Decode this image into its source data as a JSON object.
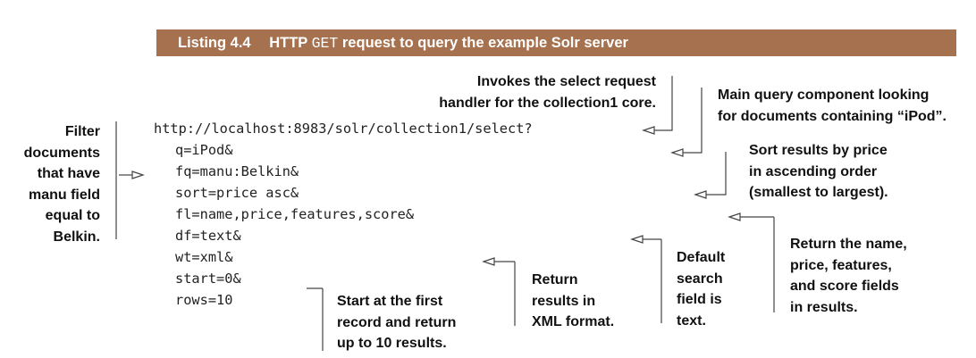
{
  "listing": {
    "number": "Listing 4.4",
    "title_prefix": "HTTP",
    "title_code": "GET",
    "title_suffix": "request to query the example Solr server"
  },
  "code_lines": [
    "http://localhost:8983/solr/collection1/select?",
    "q=iPod&",
    "fq=manu:Belkin&",
    "sort=price asc&",
    "fl=name,price,features,score&",
    "df=text&",
    "wt=xml&",
    "start=0&",
    "rows=10"
  ],
  "annotations": {
    "select": [
      "Invokes the select request",
      "handler for the collection1 core."
    ],
    "query": [
      "Main query component looking",
      "for documents containing “iPod”."
    ],
    "sort": [
      "Sort results by price",
      "in ascending order",
      "(smallest to largest)."
    ],
    "fields": [
      "Return the name,",
      "price, features,",
      "and score fields",
      "in results."
    ],
    "df": [
      "Default",
      "search",
      "field is",
      "text."
    ],
    "wt": [
      "Return",
      "results in",
      "XML format."
    ],
    "start": [
      "Start at the first",
      "record and return",
      "up to 10 results."
    ],
    "filter": [
      "Filter",
      "documents",
      "that have",
      "manu field",
      "equal to",
      "Belkin."
    ]
  },
  "colors": {
    "banner": "#a5714f",
    "banner_text": "#ffffff",
    "code": "#222222",
    "annotation": "#111111"
  }
}
